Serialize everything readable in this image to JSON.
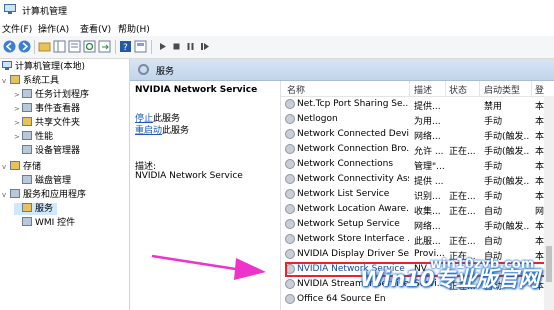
{
  "window": {
    "title": "计算机管理"
  },
  "menu": [
    "文件(F)",
    "操作(A)",
    "查看(V)",
    "帮助(H)"
  ],
  "tree": {
    "root": "计算机管理(本地)",
    "items": [
      {
        "label": "系统工具",
        "level": 1,
        "expander": "v"
      },
      {
        "label": "任务计划程序",
        "level": 2,
        "expander": ">"
      },
      {
        "label": "事件查看器",
        "level": 2,
        "expander": ">"
      },
      {
        "label": "共享文件夹",
        "level": 2,
        "expander": ">"
      },
      {
        "label": "性能",
        "level": 2,
        "expander": ">"
      },
      {
        "label": "设备管理器",
        "level": 2,
        "expander": ""
      },
      {
        "label": "存储",
        "level": 1,
        "expander": "v"
      },
      {
        "label": "磁盘管理",
        "level": 2,
        "expander": ""
      },
      {
        "label": "服务和应用程序",
        "level": 1,
        "expander": "v"
      },
      {
        "label": "服务",
        "level": 2,
        "expander": "",
        "selected": true
      },
      {
        "label": "WMI 控件",
        "level": 2,
        "expander": ""
      }
    ]
  },
  "panel_header": "服务",
  "detail": {
    "service_name": "NVIDIA Network Service",
    "stop_link": "停止",
    "stop_suffix": "此服务",
    "restart_link": "重启动",
    "restart_suffix": "此服务",
    "desc_label": "描述:",
    "desc_text": "NVIDIA Network Service"
  },
  "columns": [
    "名称",
    "描述",
    "状态",
    "启动类型",
    "登"
  ],
  "rows": [
    {
      "name": "Net.Tcp Port Sharing Se...",
      "desc": "提供...",
      "status": "",
      "startup": "禁用",
      "logon": "本"
    },
    {
      "name": "Netlogon",
      "desc": "为用...",
      "status": "",
      "startup": "手动",
      "logon": "本"
    },
    {
      "name": "Network Connected Devi...",
      "desc": "网络...",
      "status": "",
      "startup": "手动(触发...",
      "logon": "本"
    },
    {
      "name": "Network Connection Bro...",
      "desc": "允许 ...",
      "status": "正在...",
      "startup": "手动(触发...",
      "logon": "本"
    },
    {
      "name": "Network Connections",
      "desc": "管理\"...",
      "status": "",
      "startup": "手动",
      "logon": "本"
    },
    {
      "name": "Network Connectivity Ass...",
      "desc": "提供 ...",
      "status": "",
      "startup": "手动(触发...",
      "logon": "本"
    },
    {
      "name": "Network List Service",
      "desc": "识别...",
      "status": "正在...",
      "startup": "手动",
      "logon": "本"
    },
    {
      "name": "Network Location Aware...",
      "desc": "收集...",
      "status": "正在...",
      "startup": "自动",
      "logon": "网"
    },
    {
      "name": "Network Setup Service",
      "desc": "网络...",
      "status": "",
      "startup": "手动(触发...",
      "logon": "本"
    },
    {
      "name": "Network Store Interface ...",
      "desc": "此服...",
      "status": "正在...",
      "startup": "自动",
      "logon": "本"
    },
    {
      "name": "NVIDIA Display Driver Se...",
      "desc": "Provi...",
      "status": "正在...",
      "startup": "自动",
      "logon": "本"
    },
    {
      "name": "NVIDIA Network Service",
      "desc": "NV",
      "status": "",
      "startup": "",
      "logon": "",
      "selected": true
    },
    {
      "name": "NVIDIA Streamer Service",
      "desc": "Servi...",
      "status": "正在...",
      "startup": "自动",
      "logon": "本"
    },
    {
      "name": "Office 64 Source En",
      "desc": "",
      "status": "",
      "startup": "",
      "logon": ""
    }
  ],
  "watermark": {
    "main": "Win10专业版官网",
    "sub": "win10zyb.com"
  },
  "colors": {
    "highlight_box": "#e8232a",
    "arrow": "#ee33cc",
    "link": "#1a5bb5"
  }
}
